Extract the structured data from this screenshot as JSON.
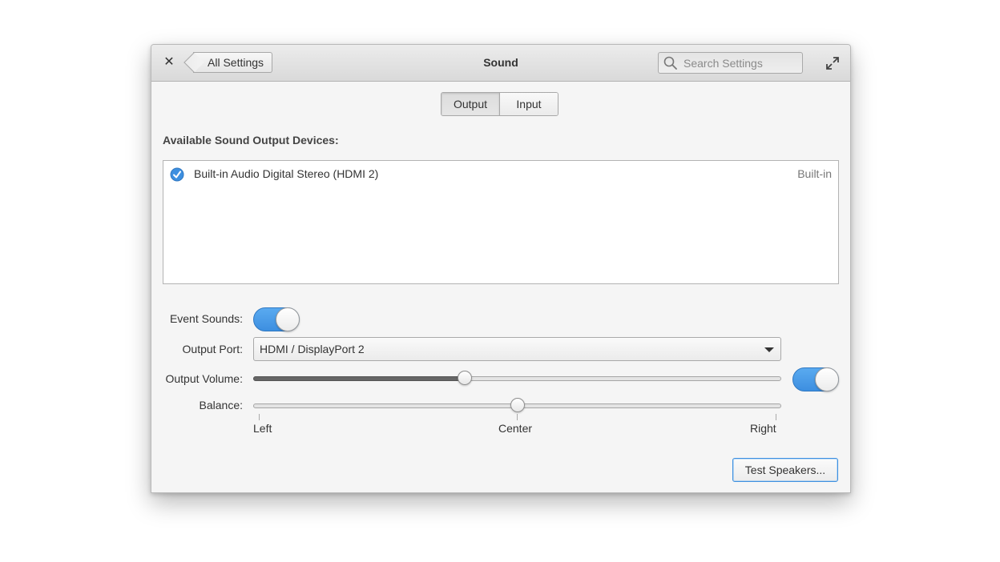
{
  "window": {
    "title": "Sound",
    "back_label": "All Settings",
    "search_placeholder": "Search Settings"
  },
  "tabs": [
    {
      "label": "Output",
      "active": true
    },
    {
      "label": "Input",
      "active": false
    }
  ],
  "devices_header": "Available Sound Output Devices:",
  "devices": [
    {
      "name": "Built-in Audio Digital Stereo (HDMI 2)",
      "tag": "Built-in",
      "selected": true
    }
  ],
  "event_sounds": {
    "label": "Event Sounds:",
    "enabled": true
  },
  "output_port": {
    "label": "Output Port:",
    "value": "HDMI / DisplayPort 2"
  },
  "output_volume": {
    "label": "Output Volume:",
    "level": 0.4,
    "enabled": true
  },
  "balance": {
    "label": "Balance:",
    "level": 0.5,
    "marks": [
      "Left",
      "Center",
      "Right"
    ]
  },
  "test_button": "Test Speakers...",
  "colors": {
    "accent": "#3d8fe0"
  }
}
